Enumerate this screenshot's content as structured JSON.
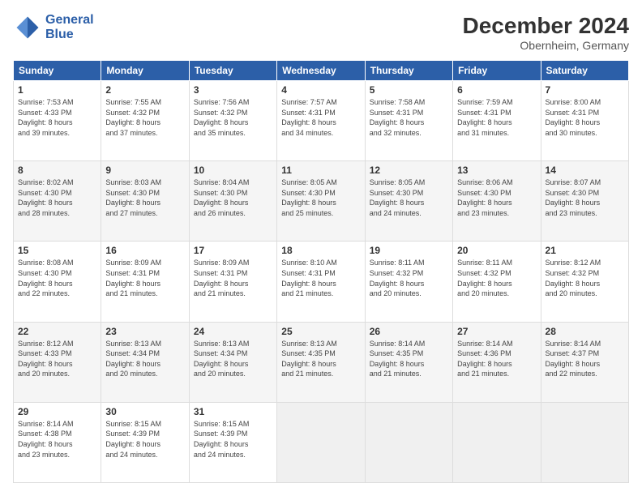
{
  "header": {
    "logo_text_line1": "General",
    "logo_text_line2": "Blue",
    "month_title": "December 2024",
    "subtitle": "Obernheim, Germany"
  },
  "weekdays": [
    "Sunday",
    "Monday",
    "Tuesday",
    "Wednesday",
    "Thursday",
    "Friday",
    "Saturday"
  ],
  "weeks": [
    [
      {
        "day": 1,
        "sunrise": "7:53 AM",
        "sunset": "4:33 PM",
        "daylight": "8 hours and 39 minutes."
      },
      {
        "day": 2,
        "sunrise": "7:55 AM",
        "sunset": "4:32 PM",
        "daylight": "8 hours and 37 minutes."
      },
      {
        "day": 3,
        "sunrise": "7:56 AM",
        "sunset": "4:32 PM",
        "daylight": "8 hours and 35 minutes."
      },
      {
        "day": 4,
        "sunrise": "7:57 AM",
        "sunset": "4:31 PM",
        "daylight": "8 hours and 34 minutes."
      },
      {
        "day": 5,
        "sunrise": "7:58 AM",
        "sunset": "4:31 PM",
        "daylight": "8 hours and 32 minutes."
      },
      {
        "day": 6,
        "sunrise": "7:59 AM",
        "sunset": "4:31 PM",
        "daylight": "8 hours and 31 minutes."
      },
      {
        "day": 7,
        "sunrise": "8:00 AM",
        "sunset": "4:31 PM",
        "daylight": "8 hours and 30 minutes."
      }
    ],
    [
      {
        "day": 8,
        "sunrise": "8:02 AM",
        "sunset": "4:30 PM",
        "daylight": "8 hours and 28 minutes."
      },
      {
        "day": 9,
        "sunrise": "8:03 AM",
        "sunset": "4:30 PM",
        "daylight": "8 hours and 27 minutes."
      },
      {
        "day": 10,
        "sunrise": "8:04 AM",
        "sunset": "4:30 PM",
        "daylight": "8 hours and 26 minutes."
      },
      {
        "day": 11,
        "sunrise": "8:05 AM",
        "sunset": "4:30 PM",
        "daylight": "8 hours and 25 minutes."
      },
      {
        "day": 12,
        "sunrise": "8:05 AM",
        "sunset": "4:30 PM",
        "daylight": "8 hours and 24 minutes."
      },
      {
        "day": 13,
        "sunrise": "8:06 AM",
        "sunset": "4:30 PM",
        "daylight": "8 hours and 23 minutes."
      },
      {
        "day": 14,
        "sunrise": "8:07 AM",
        "sunset": "4:30 PM",
        "daylight": "8 hours and 23 minutes."
      }
    ],
    [
      {
        "day": 15,
        "sunrise": "8:08 AM",
        "sunset": "4:30 PM",
        "daylight": "8 hours and 22 minutes."
      },
      {
        "day": 16,
        "sunrise": "8:09 AM",
        "sunset": "4:31 PM",
        "daylight": "8 hours and 21 minutes."
      },
      {
        "day": 17,
        "sunrise": "8:09 AM",
        "sunset": "4:31 PM",
        "daylight": "8 hours and 21 minutes."
      },
      {
        "day": 18,
        "sunrise": "8:10 AM",
        "sunset": "4:31 PM",
        "daylight": "8 hours and 21 minutes."
      },
      {
        "day": 19,
        "sunrise": "8:11 AM",
        "sunset": "4:32 PM",
        "daylight": "8 hours and 20 minutes."
      },
      {
        "day": 20,
        "sunrise": "8:11 AM",
        "sunset": "4:32 PM",
        "daylight": "8 hours and 20 minutes."
      },
      {
        "day": 21,
        "sunrise": "8:12 AM",
        "sunset": "4:32 PM",
        "daylight": "8 hours and 20 minutes."
      }
    ],
    [
      {
        "day": 22,
        "sunrise": "8:12 AM",
        "sunset": "4:33 PM",
        "daylight": "8 hours and 20 minutes."
      },
      {
        "day": 23,
        "sunrise": "8:13 AM",
        "sunset": "4:34 PM",
        "daylight": "8 hours and 20 minutes."
      },
      {
        "day": 24,
        "sunrise": "8:13 AM",
        "sunset": "4:34 PM",
        "daylight": "8 hours and 20 minutes."
      },
      {
        "day": 25,
        "sunrise": "8:13 AM",
        "sunset": "4:35 PM",
        "daylight": "8 hours and 21 minutes."
      },
      {
        "day": 26,
        "sunrise": "8:14 AM",
        "sunset": "4:35 PM",
        "daylight": "8 hours and 21 minutes."
      },
      {
        "day": 27,
        "sunrise": "8:14 AM",
        "sunset": "4:36 PM",
        "daylight": "8 hours and 21 minutes."
      },
      {
        "day": 28,
        "sunrise": "8:14 AM",
        "sunset": "4:37 PM",
        "daylight": "8 hours and 22 minutes."
      }
    ],
    [
      {
        "day": 29,
        "sunrise": "8:14 AM",
        "sunset": "4:38 PM",
        "daylight": "8 hours and 23 minutes."
      },
      {
        "day": 30,
        "sunrise": "8:15 AM",
        "sunset": "4:39 PM",
        "daylight": "8 hours and 24 minutes."
      },
      {
        "day": 31,
        "sunrise": "8:15 AM",
        "sunset": "4:39 PM",
        "daylight": "8 hours and 24 minutes."
      },
      null,
      null,
      null,
      null
    ]
  ]
}
